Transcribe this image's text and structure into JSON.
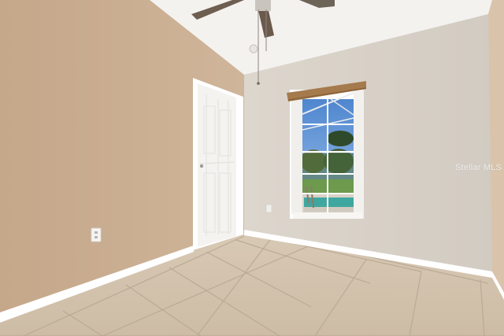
{
  "watermark": {
    "text": "Stellar MLS"
  },
  "colors": {
    "left_wall": "#c8aa8b",
    "back_wall": "#d9d3cb",
    "ceiling": "#f3f1ee",
    "floor_tile": "#d6c6b1",
    "grout": "#b9a892",
    "trim": "#ffffff",
    "door": "#f6f5f2",
    "blind": "#a57a4c",
    "pool": "#3fa79f",
    "sky": "#5c8fd1",
    "fan": "#6a5f55"
  },
  "icons": [
    "ceiling-fan-icon",
    "door-knob-icon",
    "electrical-outlet-icon"
  ]
}
